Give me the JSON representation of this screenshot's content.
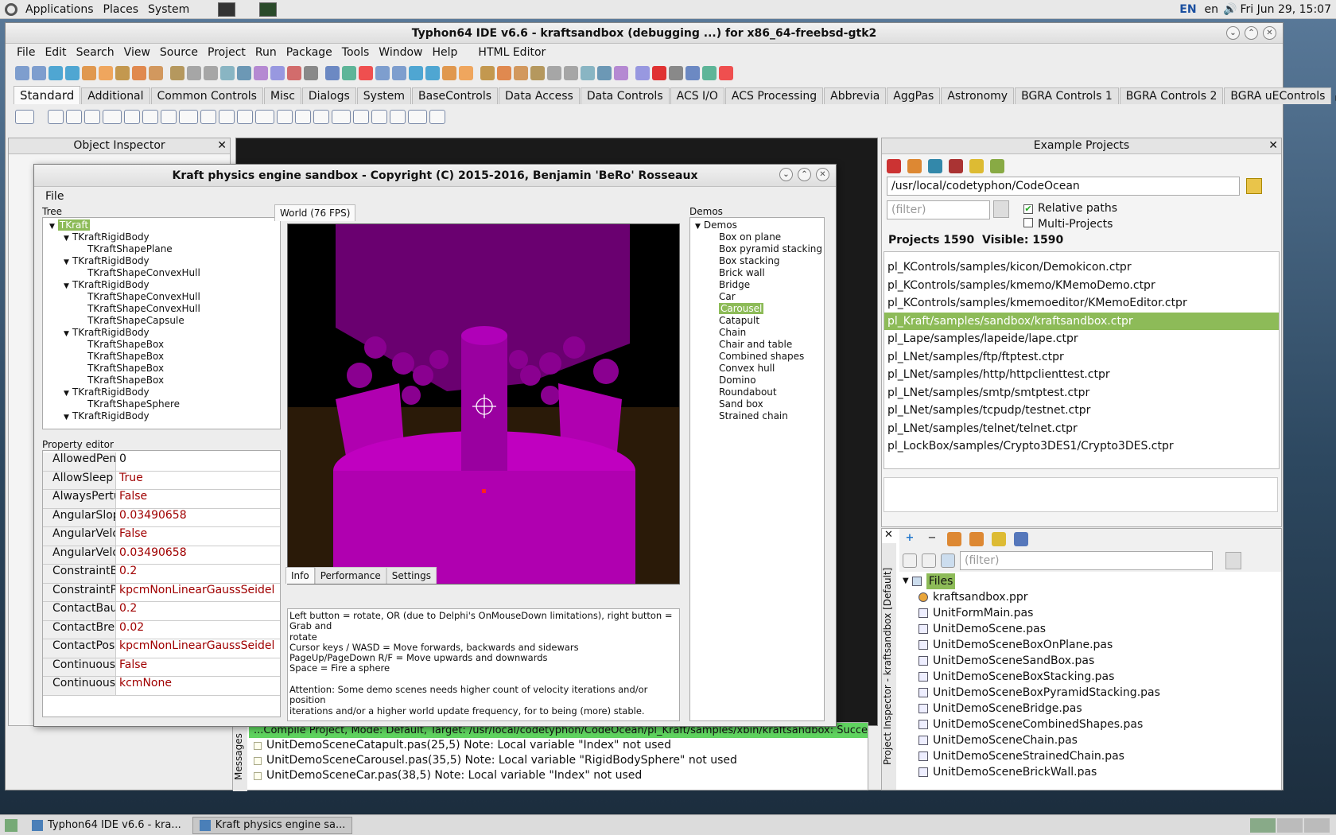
{
  "topbar": {
    "menus": [
      "Applications",
      "Places",
      "System"
    ],
    "lang": "EN",
    "lang2": "en",
    "clock": "Fri Jun 29, 15:07"
  },
  "ide": {
    "title": "Typhon64 IDE v6.6 - kraftsandbox (debugging ...) for x86_64-freebsd-gtk2",
    "menus": [
      "File",
      "Edit",
      "Search",
      "View",
      "Source",
      "Project",
      "Run",
      "Package",
      "Tools",
      "Window",
      "Help",
      "HTML Editor"
    ],
    "palette_tabs": [
      "Standard",
      "Additional",
      "Common Controls",
      "Misc",
      "Dialogs",
      "System",
      "BaseControls",
      "Data Access",
      "Data Controls",
      "ACS I/O",
      "ACS Processing",
      "Abbrevia",
      "AggPas",
      "Astronomy",
      "BGRA Controls 1",
      "BGRA Controls 2",
      "BGRA uEControls"
    ],
    "palette_extra": "64"
  },
  "object_inspector": {
    "title": "Object Inspector"
  },
  "example_projects": {
    "title": "Example Projects",
    "path": "/usr/local/codetyphon/CodeOcean",
    "filter_placeholder": "(filter)",
    "relative_paths": "Relative paths",
    "multi_projects": "Multi-Projects",
    "count": "Projects 1590  Visible: 1590",
    "items": [
      "pl_KControls/samples/kicon/Demokicon.ctpr",
      "pl_KControls/samples/kmemo/KMemoDemo.ctpr",
      "pl_KControls/samples/kmemoeditor/KMemoEditor.ctpr",
      "pl_Kraft/samples/sandbox/kraftsandbox.ctpr",
      "pl_Lape/samples/lapeide/lape.ctpr",
      "pl_LNet/samples/ftp/ftptest.ctpr",
      "pl_LNet/samples/http/httpclienttest.ctpr",
      "pl_LNet/samples/smtp/smtptest.ctpr",
      "pl_LNet/samples/tcpudp/testnet.ctpr",
      "pl_LNet/samples/telnet/telnet.ctpr",
      "pl_LockBox/samples/Crypto3DES1/Crypto3DES.ctpr"
    ],
    "selected": 3
  },
  "project_inspector": {
    "side_title": "Project Inspector - kraftsandbox [Default]",
    "filter_placeholder": "(filter)",
    "root": "Files",
    "files": [
      "kraftsandbox.ppr",
      "UnitFormMain.pas",
      "UnitDemoScene.pas",
      "UnitDemoSceneBoxOnPlane.pas",
      "UnitDemoSceneSandBox.pas",
      "UnitDemoSceneBoxStacking.pas",
      "UnitDemoSceneBoxPyramidStacking.pas",
      "UnitDemoSceneBridge.pas",
      "UnitDemoSceneCombinedShapes.pas",
      "UnitDemoSceneChain.pas",
      "UnitDemoSceneStrainedChain.pas",
      "UnitDemoSceneBrickWall.pas"
    ]
  },
  "messages": {
    "side_title": "Messages",
    "compile": "...Compile Project, Mode: Default, Target: /usr/local/codetyphon/CodeOcean/pl_Kraft/samples/xbin/kraftsandbox: Success",
    "lines": [
      "UnitDemoSceneCatapult.pas(25,5) Note: Local variable \"Index\" not used",
      "UnitDemoSceneCarousel.pas(35,5) Note: Local variable \"RigidBodySphere\" not used",
      "UnitDemoSceneCar.pas(38,5) Note: Local variable \"Index\" not used"
    ]
  },
  "kraft": {
    "title": "Kraft physics engine sandbox - Copyright (C) 2015-2016, Benjamin 'BeRo' Rosseaux",
    "menu": "File",
    "tree_label": "Tree",
    "tree": [
      {
        "t": "TKraft",
        "l": 0,
        "sel": true
      },
      {
        "t": "TKraftRigidBody",
        "l": 1
      },
      {
        "t": "TKraftShapePlane",
        "l": 2
      },
      {
        "t": "TKraftRigidBody",
        "l": 1
      },
      {
        "t": "TKraftShapeConvexHull",
        "l": 2
      },
      {
        "t": "TKraftRigidBody",
        "l": 1
      },
      {
        "t": "TKraftShapeConvexHull",
        "l": 2
      },
      {
        "t": "TKraftShapeConvexHull",
        "l": 2
      },
      {
        "t": "TKraftShapeCapsule",
        "l": 2
      },
      {
        "t": "TKraftRigidBody",
        "l": 1
      },
      {
        "t": "TKraftShapeBox",
        "l": 2
      },
      {
        "t": "TKraftShapeBox",
        "l": 2
      },
      {
        "t": "TKraftShapeBox",
        "l": 2
      },
      {
        "t": "TKraftShapeBox",
        "l": 2
      },
      {
        "t": "TKraftRigidBody",
        "l": 1
      },
      {
        "t": "TKraftShapeSphere",
        "l": 2
      },
      {
        "t": "TKraftRigidBody",
        "l": 1
      }
    ],
    "prop_label": "Property editor",
    "props": [
      [
        "AllowedPene",
        "0"
      ],
      [
        "AllowSleep",
        "True"
      ],
      [
        "AlwaysPertu",
        "False"
      ],
      [
        "AngularSlop",
        "0.03490658"
      ],
      [
        "AngularVeloc",
        "False"
      ],
      [
        "AngularVeloc",
        "0.03490658"
      ],
      [
        "ConstraintBa",
        "0.2"
      ],
      [
        "ConstraintPo",
        "kpcmNonLinearGaussSeidel"
      ],
      [
        "ContactBaum",
        "0.2"
      ],
      [
        "ContactBreak",
        "0.02"
      ],
      [
        "ContactPositi",
        "kpcmNonLinearGaussSeidel"
      ],
      [
        "ContinuousA",
        "False"
      ],
      [
        "ContinuousM",
        "kcmNone"
      ]
    ],
    "world_tab": "World (76 FPS)",
    "info_tabs": [
      "Info",
      "Performance",
      "Settings"
    ],
    "info_text": "Left button = rotate, OR (due to Delphi's OnMouseDown limitations), right button =\nGrab and\nrotate\nCursor keys / WASD = Move forwards, backwards and sidewars\nPageUp/PageDown R/F = Move upwards and downwards\nSpace = Fire a sphere\n\nAttention: Some demo scenes needs higher count of velocity iterations and/or\nposition\niterations and/or a higher world update frequency, for to being (more) stable.",
    "demos_label": "Demos",
    "demos_root": "Demos",
    "demos": [
      "Box on plane",
      "Box pyramid stacking",
      "Box stacking",
      "Brick wall",
      "Bridge",
      "Car",
      "Carousel",
      "Catapult",
      "Chain",
      "Chair and table",
      "Combined shapes",
      "Convex hull",
      "Domino",
      "Roundabout",
      "Sand box",
      "Strained chain"
    ],
    "demo_selected": 6
  },
  "taskbar": {
    "items": [
      "Typhon64 IDE v6.6 - kra...",
      "Kraft physics engine sa..."
    ]
  },
  "colors": {
    "magenta": "#c000c0",
    "selection": "#8dbb58",
    "sky": "#000000",
    "floor": "#2a1a08"
  }
}
